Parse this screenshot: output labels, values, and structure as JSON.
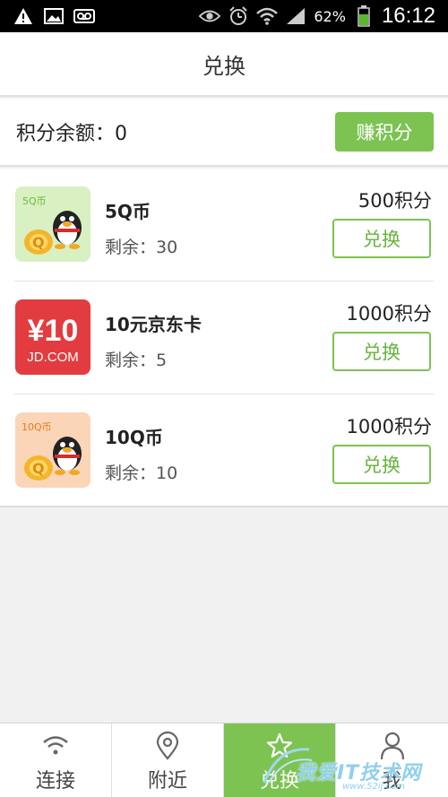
{
  "status_bar": {
    "battery_percent": "62%",
    "time": "16:12",
    "icons": [
      "warning-icon",
      "image-icon",
      "voicemail-icon",
      "eye-icon",
      "alarm-icon",
      "wifi-icon",
      "signal-icon",
      "battery-icon"
    ]
  },
  "header": {
    "title": "兑换"
  },
  "balance": {
    "label": "积分余额：0",
    "earn_button": "赚积分"
  },
  "items": [
    {
      "name": "5Q币",
      "stock": "剩余：30",
      "points": "500积分",
      "button": "兑换",
      "thumb_label": "5Q币"
    },
    {
      "name": "10元京东卡",
      "stock": "剩余：5",
      "points": "1000积分",
      "button": "兑换",
      "thumb_top": "¥10",
      "thumb_bottom": "JD.COM"
    },
    {
      "name": "10Q币",
      "stock": "剩余：10",
      "points": "1000积分",
      "button": "兑换",
      "thumb_label": "10Q币"
    }
  ],
  "tabs": [
    {
      "label": "连接",
      "icon": "wifi-icon"
    },
    {
      "label": "附近",
      "icon": "location-pin-icon"
    },
    {
      "label": "兑换",
      "icon": "star-icon",
      "active": true
    },
    {
      "label": "我",
      "icon": "person-icon"
    }
  ],
  "watermark": {
    "text": "我爱IT技术网",
    "sub": "www.52ij.com"
  },
  "colors": {
    "accent": "#7cc352",
    "jd_red": "#e23c40"
  }
}
